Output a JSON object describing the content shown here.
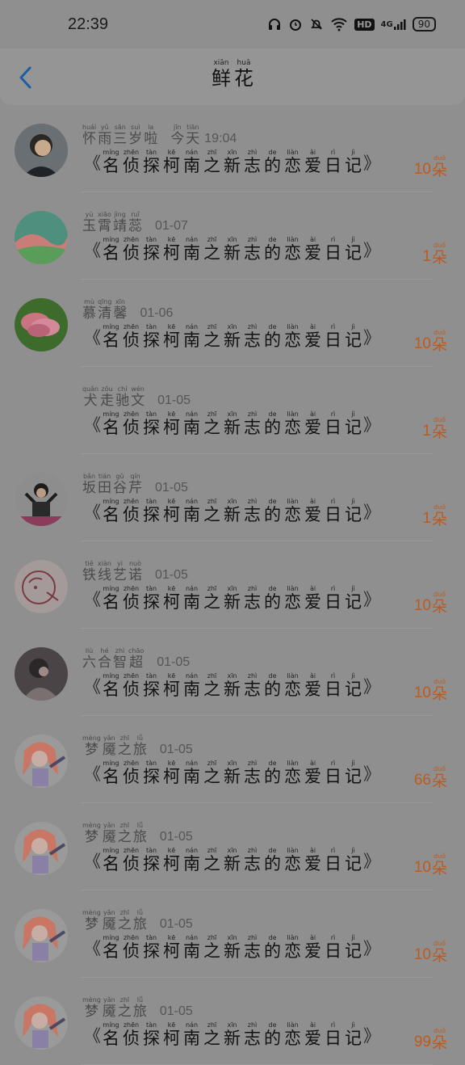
{
  "status": {
    "time": "22:39",
    "network": "4G",
    "hd": "HD",
    "battery": "90"
  },
  "header": {
    "title": [
      {
        "py": "xiān",
        "hz": "鲜"
      },
      {
        "py": "huā",
        "hz": "花"
      }
    ]
  },
  "book_title": [
    {
      "py": "míng",
      "hz": "名"
    },
    {
      "py": "zhēn",
      "hz": "侦"
    },
    {
      "py": "tàn",
      "hz": "探"
    },
    {
      "py": "kē",
      "hz": "柯"
    },
    {
      "py": "nán",
      "hz": "南"
    },
    {
      "py": "zhī",
      "hz": "之"
    },
    {
      "py": "xīn",
      "hz": "新"
    },
    {
      "py": "zhì",
      "hz": "志"
    },
    {
      "py": "de",
      "hz": "的"
    },
    {
      "py": "liàn",
      "hz": "恋"
    },
    {
      "py": "ài",
      "hz": "爱"
    },
    {
      "py": "rì",
      "hz": "日"
    },
    {
      "py": "jì",
      "hz": "记"
    }
  ],
  "book_open": "《",
  "book_close": "》",
  "unit": {
    "py": "duǒ",
    "hz": "朵"
  },
  "records": [
    {
      "name": [
        {
          "py": "huái",
          "hz": "怀"
        },
        {
          "py": "yǔ",
          "hz": "雨"
        },
        {
          "py": "sān",
          "hz": "三"
        },
        {
          "py": "suì",
          "hz": "岁"
        },
        {
          "py": "la",
          "hz": "啦"
        }
      ],
      "date": "19:04",
      "date_prefix": [
        {
          "py": "jīn",
          "hz": "今"
        },
        {
          "py": "tiān",
          "hz": "天"
        }
      ],
      "count": "10",
      "avatar": "portrait-dark"
    },
    {
      "name": [
        {
          "py": "yù",
          "hz": "玉"
        },
        {
          "py": "xiāo",
          "hz": "霄"
        },
        {
          "py": "jìng",
          "hz": "靖"
        },
        {
          "py": "ruǐ",
          "hz": "蕊"
        }
      ],
      "date": "01-07",
      "count": "1",
      "avatar": "landscape"
    },
    {
      "name": [
        {
          "py": "mù",
          "hz": "慕"
        },
        {
          "py": "qīng",
          "hz": "清"
        },
        {
          "py": "xīn",
          "hz": "馨"
        }
      ],
      "date": "01-06",
      "count": "10",
      "avatar": "flower"
    },
    {
      "name": [
        {
          "py": "quǎn",
          "hz": "犬"
        },
        {
          "py": "zǒu",
          "hz": "走"
        },
        {
          "py": "chí",
          "hz": "驰"
        },
        {
          "py": "wén",
          "hz": "文"
        }
      ],
      "date": "01-05",
      "count": "1",
      "avatar": "none"
    },
    {
      "name": [
        {
          "py": "bǎn",
          "hz": "坂"
        },
        {
          "py": "tián",
          "hz": "田"
        },
        {
          "py": "gǔ",
          "hz": "谷"
        },
        {
          "py": "qín",
          "hz": "芹"
        }
      ],
      "date": "01-05",
      "count": "1",
      "avatar": "girl"
    },
    {
      "name": [
        {
          "py": "tiě",
          "hz": "铁"
        },
        {
          "py": "xiàn",
          "hz": "线"
        },
        {
          "py": "yì",
          "hz": "艺"
        },
        {
          "py": "nuò",
          "hz": "诺"
        }
      ],
      "date": "01-05",
      "count": "10",
      "avatar": "sketch"
    },
    {
      "name": [
        {
          "py": "liù",
          "hz": "六"
        },
        {
          "py": "hé",
          "hz": "合"
        },
        {
          "py": "zhì",
          "hz": "智"
        },
        {
          "py": "chāo",
          "hz": "超"
        }
      ],
      "date": "01-05",
      "count": "10",
      "avatar": "photo-dark"
    },
    {
      "name": [
        {
          "py": "mèng",
          "hz": "梦"
        },
        {
          "py": "yǎn",
          "hz": "魇"
        },
        {
          "py": "zhī",
          "hz": "之"
        },
        {
          "py": "lǚ",
          "hz": "旅"
        }
      ],
      "date": "01-05",
      "count": "66",
      "avatar": "anime"
    },
    {
      "name": [
        {
          "py": "mèng",
          "hz": "梦"
        },
        {
          "py": "yǎn",
          "hz": "魇"
        },
        {
          "py": "zhī",
          "hz": "之"
        },
        {
          "py": "lǚ",
          "hz": "旅"
        }
      ],
      "date": "01-05",
      "count": "10",
      "avatar": "anime"
    },
    {
      "name": [
        {
          "py": "mèng",
          "hz": "梦"
        },
        {
          "py": "yǎn",
          "hz": "魇"
        },
        {
          "py": "zhī",
          "hz": "之"
        },
        {
          "py": "lǚ",
          "hz": "旅"
        }
      ],
      "date": "01-05",
      "count": "10",
      "avatar": "anime"
    },
    {
      "name": [
        {
          "py": "mèng",
          "hz": "梦"
        },
        {
          "py": "yǎn",
          "hz": "魇"
        },
        {
          "py": "zhī",
          "hz": "之"
        },
        {
          "py": "lǚ",
          "hz": "旅"
        }
      ],
      "date": "01-05",
      "count": "99",
      "avatar": "anime"
    }
  ]
}
